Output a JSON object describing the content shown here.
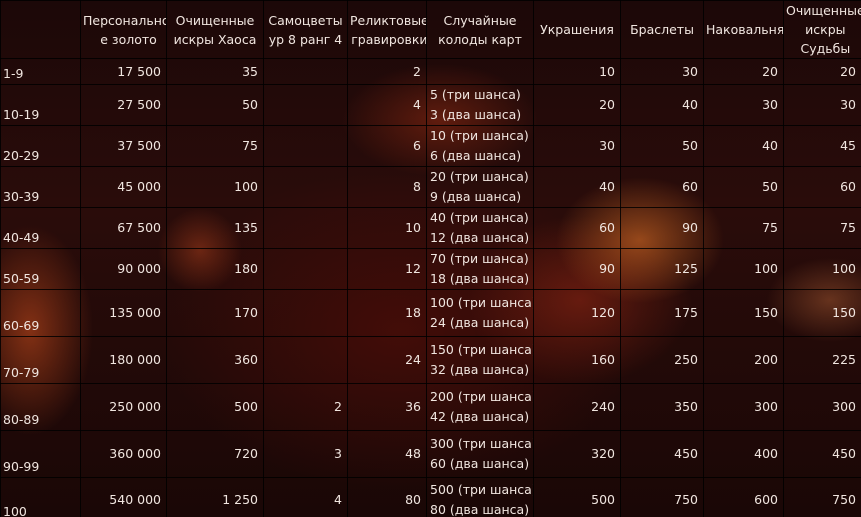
{
  "headers": [
    "",
    "Персонально­е золото",
    "Очищенные искры Хаоса",
    "Самоцветы ур 8 ранг 4",
    "Реликтовые гравировки",
    "Случайные колоды карт",
    "Украшения",
    "Браслеты",
    "Наковальня",
    "Очищенные искры Судьбы"
  ],
  "rows": [
    {
      "level": "1-9",
      "gold": "17 500",
      "chaos": "35",
      "gems": "",
      "relic": "2",
      "deck": [
        "",
        ""
      ],
      "jewelry": "10",
      "bracelets": "30",
      "anvil": "20",
      "fate": "20"
    },
    {
      "level": "10-19",
      "gold": "27 500",
      "chaos": "50",
      "gems": "",
      "relic": "4",
      "deck": [
        "5 (три шанса)",
        "3 (два шанса)"
      ],
      "jewelry": "20",
      "bracelets": "40",
      "anvil": "30",
      "fate": "30"
    },
    {
      "level": "20-29",
      "gold": "37 500",
      "chaos": "75",
      "gems": "",
      "relic": "6",
      "deck": [
        "10 (три шанса)",
        "6 (два шанса)"
      ],
      "jewelry": "30",
      "bracelets": "50",
      "anvil": "40",
      "fate": "45"
    },
    {
      "level": "30-39",
      "gold": "45 000",
      "chaos": "100",
      "gems": "",
      "relic": "8",
      "deck": [
        "20 (три шанса)",
        "9 (два шанса)"
      ],
      "jewelry": "40",
      "bracelets": "60",
      "anvil": "50",
      "fate": "60"
    },
    {
      "level": "40-49",
      "gold": "67 500",
      "chaos": "135",
      "gems": "",
      "relic": "10",
      "deck": [
        "40 (три шанса)",
        "12 (два шанса)"
      ],
      "jewelry": "60",
      "bracelets": "90",
      "anvil": "75",
      "fate": "75"
    },
    {
      "level": "50-59",
      "gold": "90 000",
      "chaos": "180",
      "gems": "",
      "relic": "12",
      "deck": [
        "70 (три шанса)",
        "18 (два шанса)"
      ],
      "jewelry": "90",
      "bracelets": "125",
      "anvil": "100",
      "fate": "100"
    },
    {
      "level": "60-69",
      "gold": "135 000",
      "chaos": "170",
      "gems": "",
      "relic": "18",
      "deck": [
        "100 (три шанса)",
        "24 (два шанса)"
      ],
      "jewelry": "120",
      "bracelets": "175",
      "anvil": "150",
      "fate": "150"
    },
    {
      "level": "70-79",
      "gold": "180 000",
      "chaos": "360",
      "gems": "",
      "relic": "24",
      "deck": [
        "150 (три шанса)",
        "32 (два шанса)"
      ],
      "jewelry": "160",
      "bracelets": "250",
      "anvil": "200",
      "fate": "225"
    },
    {
      "level": "80-89",
      "gold": "250 000",
      "chaos": "500",
      "gems": "2",
      "relic": "36",
      "deck": [
        "200 (три шанса)",
        "42 (два шанса)"
      ],
      "jewelry": "240",
      "bracelets": "350",
      "anvil": "300",
      "fate": "300"
    },
    {
      "level": "90-99",
      "gold": "360 000",
      "chaos": "720",
      "gems": "3",
      "relic": "48",
      "deck": [
        "300 (три шанса)",
        "60 (два шанса)"
      ],
      "jewelry": "320",
      "bracelets": "450",
      "anvil": "400",
      "fate": "450"
    },
    {
      "level": "100",
      "gold": "540 000",
      "chaos": "1 250",
      "gems": "4",
      "relic": "80",
      "deck": [
        "500 (три шанса)",
        "80 (два шанса)"
      ],
      "jewelry": "500",
      "bracelets": "750",
      "anvil": "600",
      "fate": "750"
    }
  ]
}
